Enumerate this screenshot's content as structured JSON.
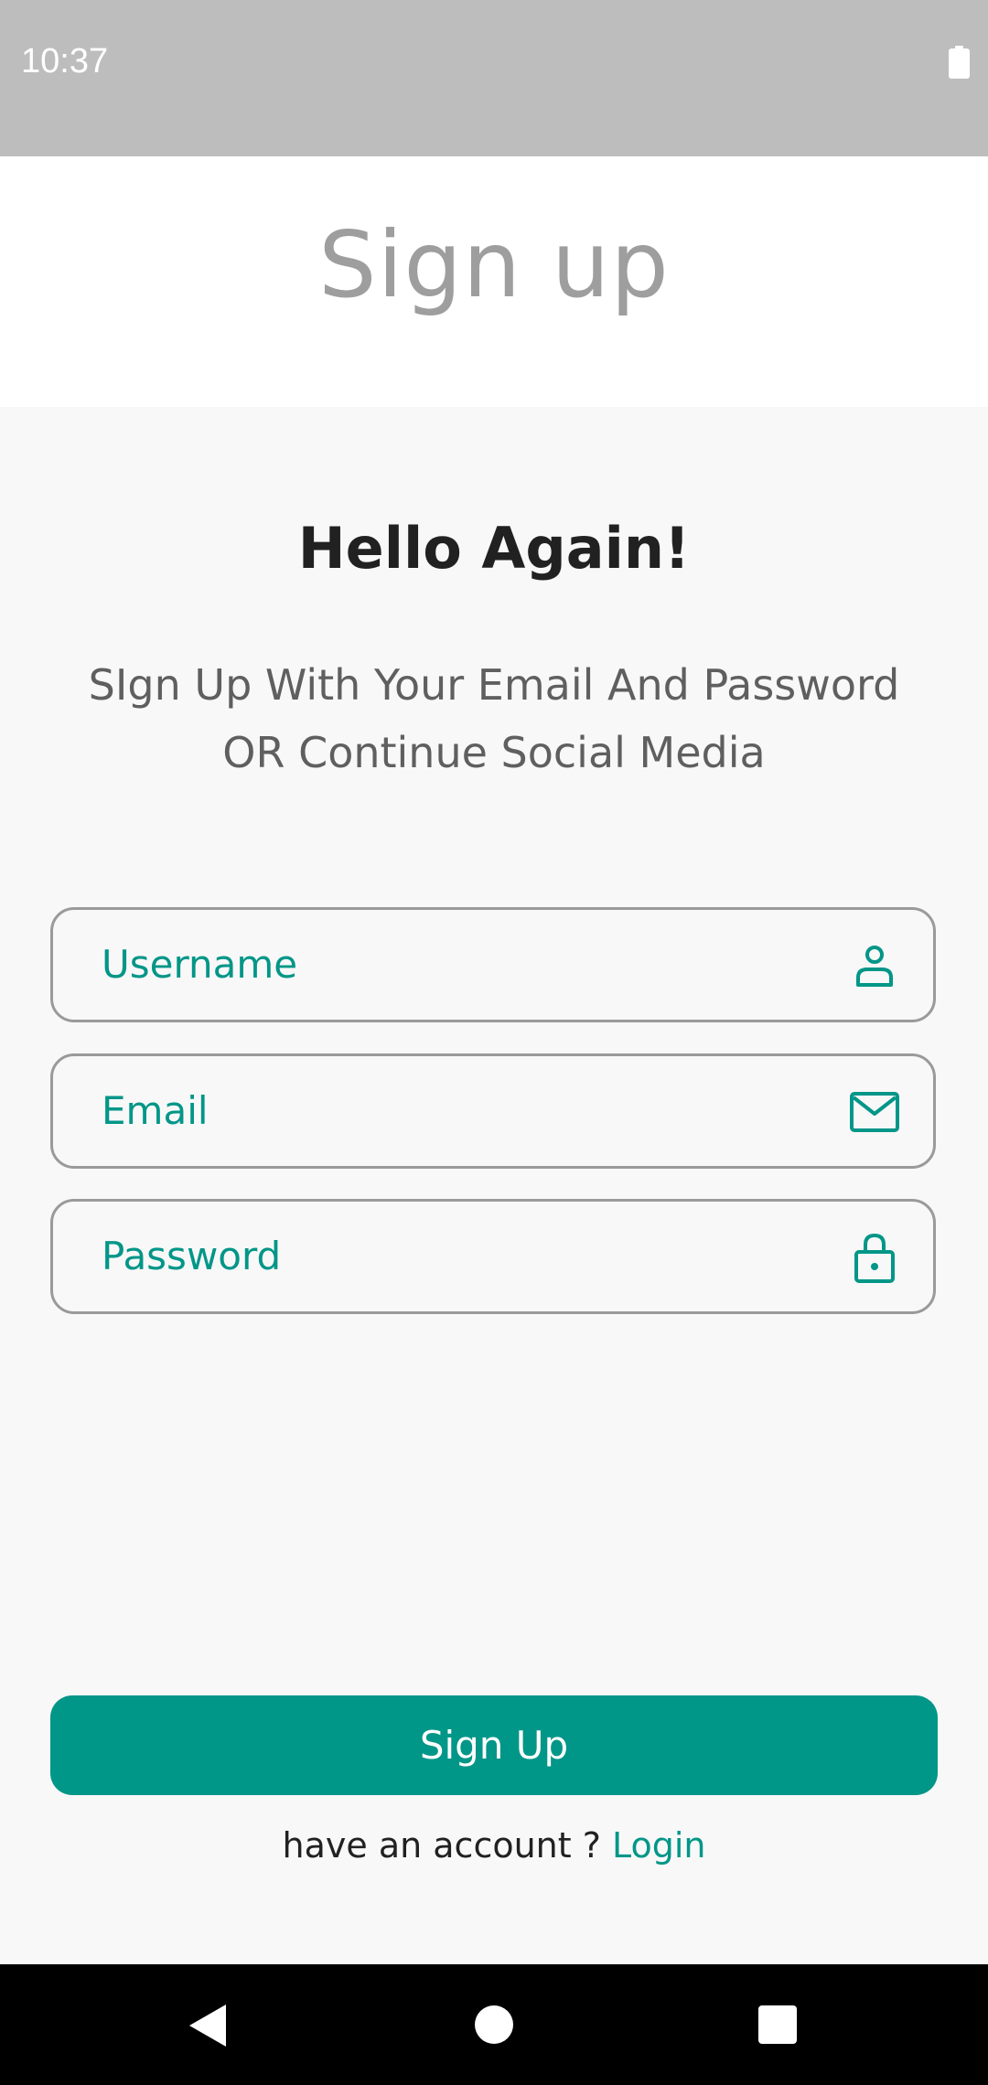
{
  "status_bar": {
    "time": "10:37",
    "icons": [
      "battery-icon"
    ]
  },
  "app_bar": {
    "title": "Sign up"
  },
  "main": {
    "headline": "Hello Again!",
    "subtitle_line1": "SIgn Up With Your Email And Password",
    "subtitle_line2": "OR Continue Social Media",
    "fields": [
      {
        "placeholder": "Username",
        "icon": "person-icon"
      },
      {
        "placeholder": "Email",
        "icon": "mail-icon"
      },
      {
        "placeholder": "Password",
        "icon": "lock-icon"
      }
    ],
    "signup_button_label": "Sign Up",
    "footer_prefix": "have an account ? ",
    "login_link": "Login"
  },
  "nav_bar": {
    "icons": [
      "back-icon",
      "home-icon",
      "recents-icon"
    ]
  },
  "colors": {
    "accent": "#009688",
    "status_bar": "#bdbdbd",
    "title_gray": "#9e9e9e",
    "background": "#f8f8f8"
  }
}
